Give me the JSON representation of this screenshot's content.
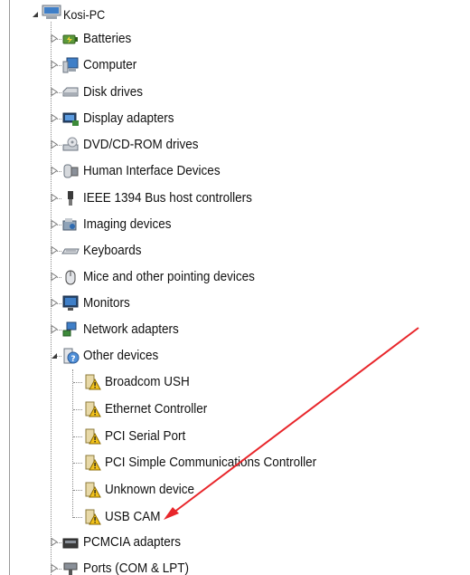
{
  "root": {
    "label": "Kosi-PC",
    "expanded": true,
    "icon": "computer-icon"
  },
  "categories": [
    {
      "label": "Batteries",
      "icon": "battery-icon",
      "expanded": false
    },
    {
      "label": "Computer",
      "icon": "computer-icon",
      "expanded": false
    },
    {
      "label": "Disk drives",
      "icon": "disk-drive-icon",
      "expanded": false
    },
    {
      "label": "Display adapters",
      "icon": "display-adapter-icon",
      "expanded": false
    },
    {
      "label": "DVD/CD-ROM drives",
      "icon": "dvd-drive-icon",
      "expanded": false
    },
    {
      "label": "Human Interface Devices",
      "icon": "hid-icon",
      "expanded": false
    },
    {
      "label": "IEEE 1394 Bus host controllers",
      "icon": "ieee1394-icon",
      "expanded": false
    },
    {
      "label": "Imaging devices",
      "icon": "camera-icon",
      "expanded": false
    },
    {
      "label": "Keyboards",
      "icon": "keyboard-icon",
      "expanded": false
    },
    {
      "label": "Mice and other pointing devices",
      "icon": "mouse-icon",
      "expanded": false
    },
    {
      "label": "Monitors",
      "icon": "monitor-icon",
      "expanded": false
    },
    {
      "label": "Network adapters",
      "icon": "network-icon",
      "expanded": false
    },
    {
      "label": "Other devices",
      "icon": "unknown-device-icon",
      "expanded": true
    },
    {
      "label": "PCMCIA adapters",
      "icon": "pcmcia-icon",
      "expanded": false
    },
    {
      "label": "Ports (COM & LPT)",
      "icon": "port-icon",
      "expanded": false
    }
  ],
  "other_devices": [
    {
      "label": "Broadcom USH",
      "icon": "warning-device-icon"
    },
    {
      "label": "Ethernet Controller",
      "icon": "warning-device-icon"
    },
    {
      "label": "PCI Serial Port",
      "icon": "warning-device-icon"
    },
    {
      "label": "PCI Simple Communications Controller",
      "icon": "warning-device-icon"
    },
    {
      "label": "Unknown device",
      "icon": "warning-device-icon"
    },
    {
      "label": "USB CAM",
      "icon": "warning-device-icon"
    }
  ],
  "colors": {
    "arrow": "#e8262b",
    "warning": "#f2c21b",
    "tree_line": "#8c8c8c"
  }
}
